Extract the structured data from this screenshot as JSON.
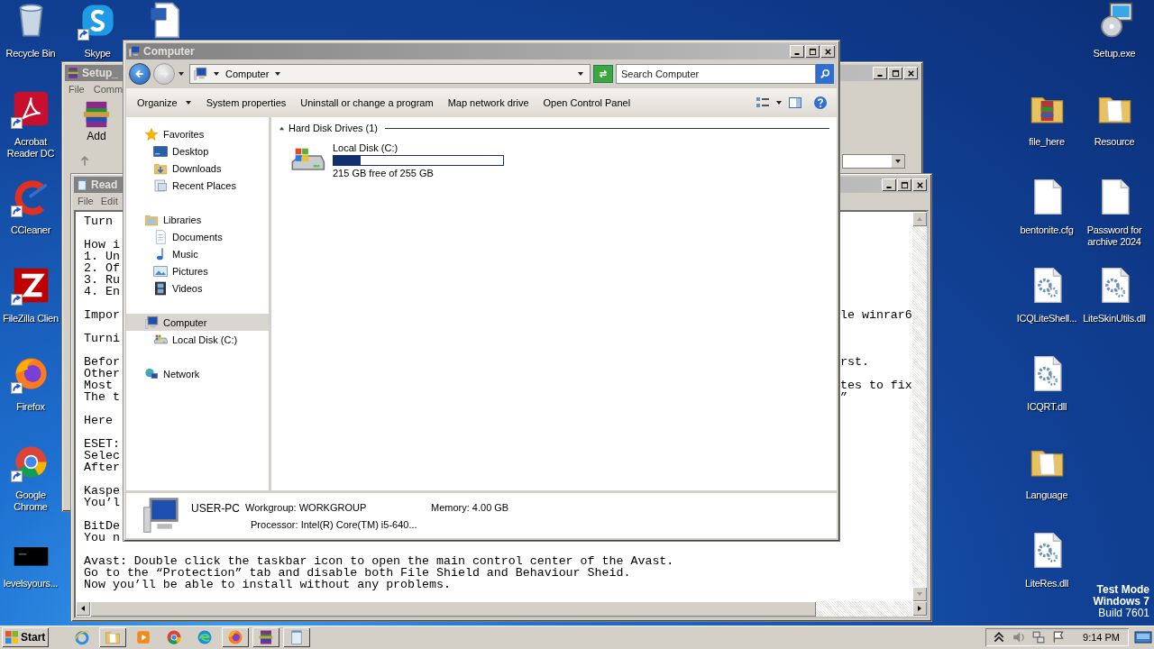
{
  "desktop_icons_left": [
    {
      "label": "Recycle Bin",
      "kind": "recycle",
      "shortcut": false
    },
    {
      "label": "Skype",
      "kind": "skype",
      "shortcut": true
    },
    {
      "kind": "word",
      "shortcut": false
    },
    {
      "label": "Acrobat Reader DC",
      "kind": "acrobat",
      "shortcut": true
    },
    {
      "label": "CCleaner",
      "kind": "ccleaner",
      "shortcut": true
    },
    {
      "label": "FileZilla Clien",
      "kind": "filezilla",
      "shortcut": true
    },
    {
      "label": "Firefox",
      "kind": "firefox",
      "shortcut": true
    },
    {
      "label": "Google Chrome",
      "kind": "chrome",
      "shortcut": true
    },
    {
      "label": "levelsyours...",
      "kind": "black",
      "shortcut": false
    }
  ],
  "desktop_icons_right": [
    {
      "label": "Setup.exe",
      "kind": "setup",
      "shortcut": false
    },
    {
      "label": "file_here",
      "kind": "archive-folder",
      "shortcut": false
    },
    {
      "label": "Resource",
      "kind": "folder",
      "shortcut": false
    },
    {
      "label": "bentonite.cfg",
      "kind": "file",
      "shortcut": false
    },
    {
      "label": "Password for archive 2024",
      "kind": "file",
      "shortcut": false
    },
    {
      "label": "ICQLiteShell...",
      "kind": "dll",
      "shortcut": false
    },
    {
      "label": "LiteSkinUtils.dll",
      "kind": "dll",
      "shortcut": false
    },
    {
      "label": "ICQRT.dll",
      "kind": "dll",
      "shortcut": false
    },
    {
      "label": "Language",
      "kind": "folder",
      "shortcut": false
    },
    {
      "label": "LiteRes.dll",
      "kind": "dll",
      "shortcut": false
    }
  ],
  "os_badge": {
    "edition": "Test Mode",
    "version": "Windows 7",
    "build": "Build 7601"
  },
  "setup_window": {
    "title": "Setup_",
    "menu": [
      "File",
      "Comm"
    ],
    "tools": [
      {
        "label": "Add"
      }
    ]
  },
  "notepad": {
    "title": "Read",
    "menu": [
      "File",
      "Edit"
    ],
    "lines": [
      {
        "kind": "split",
        "left": "Turn"
      },
      {
        "kind": "blank"
      },
      {
        "kind": "split",
        "left": "How i"
      },
      {
        "kind": "split",
        "left": "1. Un"
      },
      {
        "kind": "split",
        "left": "2. Of"
      },
      {
        "kind": "split",
        "left": "3. Ru"
      },
      {
        "kind": "split",
        "left": "4. En"
      },
      {
        "kind": "blank"
      },
      {
        "kind": "split",
        "left": "Impor",
        "right": "le winrar6"
      },
      {
        "kind": "blank"
      },
      {
        "kind": "split",
        "left": "Turni"
      },
      {
        "kind": "blank"
      },
      {
        "kind": "split",
        "left": "Befor",
        "right": "rst."
      },
      {
        "kind": "split",
        "left": "Other"
      },
      {
        "kind": "split",
        "left": "Most",
        "right": "tes to fix"
      },
      {
        "kind": "split",
        "left": "The t",
        "right": "”"
      },
      {
        "kind": "blank"
      },
      {
        "kind": "split",
        "left": "Here"
      },
      {
        "kind": "blank"
      },
      {
        "kind": "split",
        "left": "ESET:"
      },
      {
        "kind": "split",
        "left": "Selec"
      },
      {
        "kind": "split",
        "left": "After"
      },
      {
        "kind": "blank"
      },
      {
        "kind": "split",
        "left": "Kaspe"
      },
      {
        "kind": "split",
        "left": "You’l"
      },
      {
        "kind": "blank"
      },
      {
        "kind": "split",
        "left": "BitDe"
      },
      {
        "kind": "split",
        "left": "You n"
      },
      {
        "kind": "blank"
      },
      {
        "kind": "full",
        "text": "Avast: Double click the taskbar icon to open the main control center of the Avast."
      },
      {
        "kind": "full",
        "text": "Go to the “Protection” tab and disable both File Shield and Behaviour Sheid."
      },
      {
        "kind": "full",
        "text": "Now you’ll be able to install without any problems."
      }
    ]
  },
  "explorer": {
    "title": "Computer",
    "address": "Computer",
    "search": {
      "placeholder": "Search Computer"
    },
    "commands": [
      {
        "label": "Organize",
        "dropdown": true
      },
      {
        "label": "System properties",
        "dropdown": false
      },
      {
        "label": "Uninstall or change a program",
        "dropdown": false
      },
      {
        "label": "Map network drive",
        "dropdown": false
      },
      {
        "label": "Open Control Panel",
        "dropdown": false
      }
    ],
    "nav": [
      {
        "label": "Favorites",
        "kind": "star",
        "selected": false,
        "children": [
          {
            "label": "Desktop",
            "kind": "desktop",
            "selected": false
          },
          {
            "label": "Downloads",
            "kind": "downloads",
            "selected": false
          },
          {
            "label": "Recent Places",
            "kind": "recent",
            "selected": false
          }
        ]
      },
      {
        "label": "Libraries",
        "kind": "libraries",
        "selected": false,
        "children": [
          {
            "label": "Documents",
            "kind": "document",
            "selected": false
          },
          {
            "label": "Music",
            "kind": "music",
            "selected": false
          },
          {
            "label": "Pictures",
            "kind": "pictures",
            "selected": false
          },
          {
            "label": "Videos",
            "kind": "videos",
            "selected": false
          }
        ]
      },
      {
        "label": "Computer",
        "kind": "computer",
        "selected": true,
        "children": [
          {
            "label": "Local Disk (C:)",
            "kind": "disk",
            "selected": false
          }
        ]
      },
      {
        "label": "Network",
        "kind": "network",
        "selected": false
      }
    ],
    "group": "Hard Disk Drives (1)",
    "drives": [
      {
        "name": "Local Disk (C:)",
        "level": 0.16,
        "free": "215 GB free of 255 GB"
      }
    ],
    "details": {
      "name": "USER-PC",
      "workgroup": "Workgroup: WORKGROUP",
      "memory": "Memory: 4.00 GB",
      "processor": "Processor: Intel(R) Core(TM) i5-640..."
    }
  },
  "taskbar": {
    "start": "Start",
    "apps": [
      {
        "kind": "ie",
        "open": false
      },
      {
        "kind": "folder",
        "open": true
      },
      {
        "kind": "media",
        "open": false
      },
      {
        "kind": "chrome",
        "open": false
      },
      {
        "kind": "edge",
        "open": false
      },
      {
        "kind": "firefox",
        "open": true
      },
      {
        "kind": "winrar",
        "open": true
      },
      {
        "kind": "notepad",
        "open": true
      }
    ],
    "clock": "9:14 PM"
  }
}
